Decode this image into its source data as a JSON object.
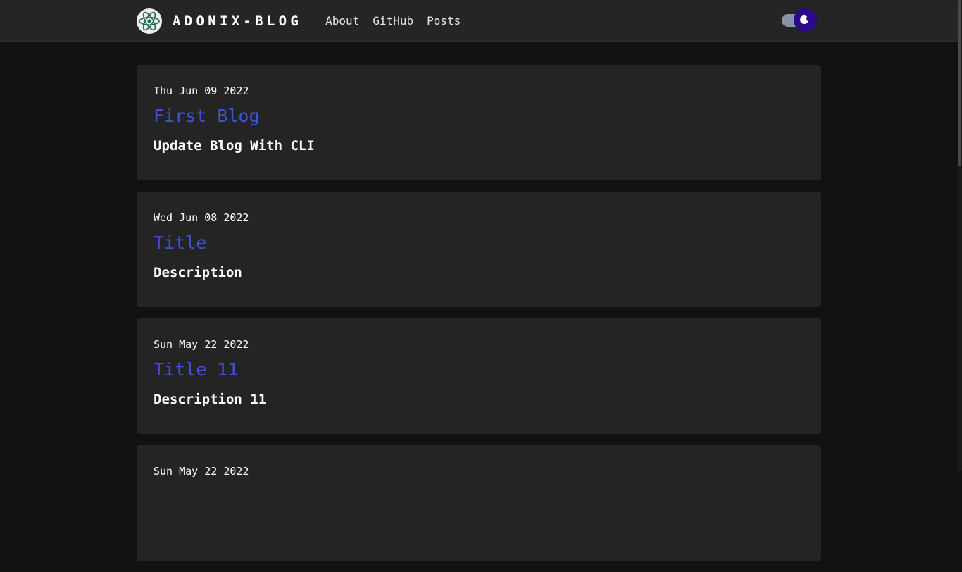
{
  "brand": {
    "name": "ADONIX-BLOG",
    "logo_icon": "atom-icon",
    "logo_color": "#1f6b55"
  },
  "nav": {
    "links": [
      {
        "label": "About"
      },
      {
        "label": "GitHub"
      },
      {
        "label": "Posts"
      }
    ]
  },
  "theme_toggle": {
    "icon": "moon-icon",
    "state": "dark",
    "knob_color": "#2a0a8a",
    "track_color": "#8a93a6"
  },
  "colors": {
    "background": "#121212",
    "navbar": "#252525",
    "card": "#242424",
    "title_link": "#3f51d6",
    "text": "#ffffff"
  },
  "posts": [
    {
      "date": "Thu Jun 09 2022",
      "title": "First Blog",
      "description": "Update Blog With CLI"
    },
    {
      "date": "Wed Jun 08 2022",
      "title": "Title",
      "description": "Description"
    },
    {
      "date": "Sun May 22 2022",
      "title": "Title 11",
      "description": "Description 11"
    },
    {
      "date": "Sun May 22 2022",
      "title": "",
      "description": ""
    }
  ]
}
